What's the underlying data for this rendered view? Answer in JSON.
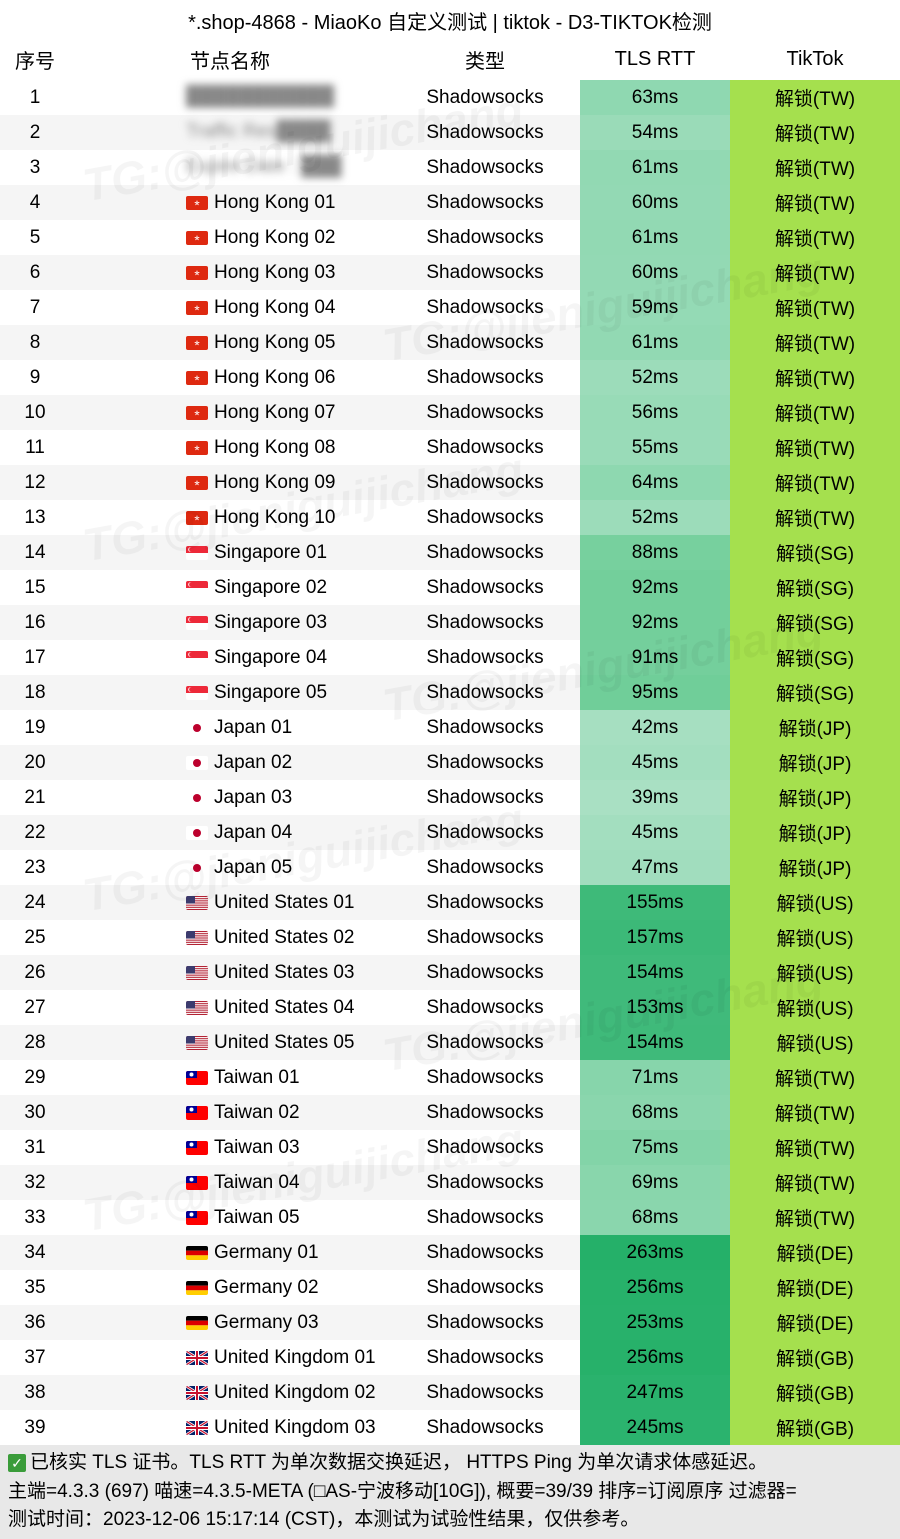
{
  "title": "*.shop-4868 - MiaoKo 自定义测试 | tiktok - D3-TIKTOK检测",
  "columns": {
    "idx": "序号",
    "name": "节点名称",
    "type": "类型",
    "rtt": "TLS RTT",
    "tiktok": "TikTok"
  },
  "watermark": "TG:@jieniguijichang",
  "nodes": [
    {
      "idx": 1,
      "flag": "",
      "name": "███████████",
      "type": "Shadowsocks",
      "rtt": "63ms",
      "rtt_bg": "#8fd8b1",
      "tt": "解锁(TW)",
      "tt_bg": "#a5e04e",
      "blur": true
    },
    {
      "idx": 2,
      "flag": "",
      "name": "Traffic Res████",
      "type": "Shadowsocks",
      "rtt": "54ms",
      "rtt_bg": "#9adbb8",
      "tt": "解锁(TW)",
      "tt_bg": "#a5e04e",
      "blur": true
    },
    {
      "idx": 3,
      "flag": "",
      "name": "Expire Date : ███",
      "type": "Shadowsocks",
      "rtt": "61ms",
      "rtt_bg": "#92d9b3",
      "tt": "解锁(TW)",
      "tt_bg": "#a5e04e",
      "blur": true
    },
    {
      "idx": 4,
      "flag": "hk",
      "name": "Hong Kong 01",
      "type": "Shadowsocks",
      "rtt": "60ms",
      "rtt_bg": "#93d9b4",
      "tt": "解锁(TW)",
      "tt_bg": "#a5e04e"
    },
    {
      "idx": 5,
      "flag": "hk",
      "name": "Hong Kong 02",
      "type": "Shadowsocks",
      "rtt": "61ms",
      "rtt_bg": "#92d9b3",
      "tt": "解锁(TW)",
      "tt_bg": "#a5e04e"
    },
    {
      "idx": 6,
      "flag": "hk",
      "name": "Hong Kong 03",
      "type": "Shadowsocks",
      "rtt": "60ms",
      "rtt_bg": "#93d9b4",
      "tt": "解锁(TW)",
      "tt_bg": "#a5e04e"
    },
    {
      "idx": 7,
      "flag": "hk",
      "name": "Hong Kong 04",
      "type": "Shadowsocks",
      "rtt": "59ms",
      "rtt_bg": "#94dab5",
      "tt": "解锁(TW)",
      "tt_bg": "#a5e04e"
    },
    {
      "idx": 8,
      "flag": "hk",
      "name": "Hong Kong 05",
      "type": "Shadowsocks",
      "rtt": "61ms",
      "rtt_bg": "#92d9b3",
      "tt": "解锁(TW)",
      "tt_bg": "#a5e04e"
    },
    {
      "idx": 9,
      "flag": "hk",
      "name": "Hong Kong 06",
      "type": "Shadowsocks",
      "rtt": "52ms",
      "rtt_bg": "#9cdcba",
      "tt": "解锁(TW)",
      "tt_bg": "#a5e04e"
    },
    {
      "idx": 10,
      "flag": "hk",
      "name": "Hong Kong 07",
      "type": "Shadowsocks",
      "rtt": "56ms",
      "rtt_bg": "#98dbb7",
      "tt": "解锁(TW)",
      "tt_bg": "#a5e04e"
    },
    {
      "idx": 11,
      "flag": "hk",
      "name": "Hong Kong 08",
      "type": "Shadowsocks",
      "rtt": "55ms",
      "rtt_bg": "#99dbb8",
      "tt": "解锁(TW)",
      "tt_bg": "#a5e04e"
    },
    {
      "idx": 12,
      "flag": "hk",
      "name": "Hong Kong 09",
      "type": "Shadowsocks",
      "rtt": "64ms",
      "rtt_bg": "#8ed8b0",
      "tt": "解锁(TW)",
      "tt_bg": "#a5e04e"
    },
    {
      "idx": 13,
      "flag": "hk",
      "name": "Hong Kong 10",
      "type": "Shadowsocks",
      "rtt": "52ms",
      "rtt_bg": "#9cdcba",
      "tt": "解锁(TW)",
      "tt_bg": "#a5e04e"
    },
    {
      "idx": 14,
      "flag": "sg",
      "name": "Singapore 01",
      "type": "Shadowsocks",
      "rtt": "88ms",
      "rtt_bg": "#77d09e",
      "tt": "解锁(SG)",
      "tt_bg": "#a5e04e"
    },
    {
      "idx": 15,
      "flag": "sg",
      "name": "Singapore 02",
      "type": "Shadowsocks",
      "rtt": "92ms",
      "rtt_bg": "#73cf9b",
      "tt": "解锁(SG)",
      "tt_bg": "#a5e04e"
    },
    {
      "idx": 16,
      "flag": "sg",
      "name": "Singapore 03",
      "type": "Shadowsocks",
      "rtt": "92ms",
      "rtt_bg": "#73cf9b",
      "tt": "解锁(SG)",
      "tt_bg": "#a5e04e"
    },
    {
      "idx": 17,
      "flag": "sg",
      "name": "Singapore 04",
      "type": "Shadowsocks",
      "rtt": "91ms",
      "rtt_bg": "#74cf9c",
      "tt": "解锁(SG)",
      "tt_bg": "#a5e04e"
    },
    {
      "idx": 18,
      "flag": "sg",
      "name": "Singapore 05",
      "type": "Shadowsocks",
      "rtt": "95ms",
      "rtt_bg": "#70ce99",
      "tt": "解锁(SG)",
      "tt_bg": "#a5e04e"
    },
    {
      "idx": 19,
      "flag": "jp",
      "name": "Japan 01",
      "type": "Shadowsocks",
      "rtt": "42ms",
      "rtt_bg": "#a6dfc1",
      "tt": "解锁(JP)",
      "tt_bg": "#a5e04e"
    },
    {
      "idx": 20,
      "flag": "jp",
      "name": "Japan 02",
      "type": "Shadowsocks",
      "rtt": "45ms",
      "rtt_bg": "#a3debf",
      "tt": "解锁(JP)",
      "tt_bg": "#a5e04e"
    },
    {
      "idx": 21,
      "flag": "jp",
      "name": "Japan 03",
      "type": "Shadowsocks",
      "rtt": "39ms",
      "rtt_bg": "#a9e0c3",
      "tt": "解锁(JP)",
      "tt_bg": "#a5e04e"
    },
    {
      "idx": 22,
      "flag": "jp",
      "name": "Japan 04",
      "type": "Shadowsocks",
      "rtt": "45ms",
      "rtt_bg": "#a3debf",
      "tt": "解锁(JP)",
      "tt_bg": "#a5e04e"
    },
    {
      "idx": 23,
      "flag": "jp",
      "name": "Japan 05",
      "type": "Shadowsocks",
      "rtt": "47ms",
      "rtt_bg": "#a1ddbe",
      "tt": "解锁(JP)",
      "tt_bg": "#a5e04e"
    },
    {
      "idx": 24,
      "flag": "us",
      "name": "United States 01",
      "type": "Shadowsocks",
      "rtt": "155ms",
      "rtt_bg": "#3eba79",
      "tt": "解锁(US)",
      "tt_bg": "#a5e04e"
    },
    {
      "idx": 25,
      "flag": "us",
      "name": "United States 02",
      "type": "Shadowsocks",
      "rtt": "157ms",
      "rtt_bg": "#3cb978",
      "tt": "解锁(US)",
      "tt_bg": "#a5e04e"
    },
    {
      "idx": 26,
      "flag": "us",
      "name": "United States 03",
      "type": "Shadowsocks",
      "rtt": "154ms",
      "rtt_bg": "#3fba7a",
      "tt": "解锁(US)",
      "tt_bg": "#a5e04e"
    },
    {
      "idx": 27,
      "flag": "us",
      "name": "United States 04",
      "type": "Shadowsocks",
      "rtt": "153ms",
      "rtt_bg": "#40ba7b",
      "tt": "解锁(US)",
      "tt_bg": "#a5e04e"
    },
    {
      "idx": 28,
      "flag": "us",
      "name": "United States 05",
      "type": "Shadowsocks",
      "rtt": "154ms",
      "rtt_bg": "#3fba7a",
      "tt": "解锁(US)",
      "tt_bg": "#a5e04e"
    },
    {
      "idx": 29,
      "flag": "tw",
      "name": "Taiwan 01",
      "type": "Shadowsocks",
      "rtt": "71ms",
      "rtt_bg": "#87d5ab",
      "tt": "解锁(TW)",
      "tt_bg": "#a5e04e"
    },
    {
      "idx": 30,
      "flag": "tw",
      "name": "Taiwan 02",
      "type": "Shadowsocks",
      "rtt": "68ms",
      "rtt_bg": "#8ad6ad",
      "tt": "解锁(TW)",
      "tt_bg": "#a5e04e"
    },
    {
      "idx": 31,
      "flag": "tw",
      "name": "Taiwan 03",
      "type": "Shadowsocks",
      "rtt": "75ms",
      "rtt_bg": "#83d4a8",
      "tt": "解锁(TW)",
      "tt_bg": "#a5e04e"
    },
    {
      "idx": 32,
      "flag": "tw",
      "name": "Taiwan 04",
      "type": "Shadowsocks",
      "rtt": "69ms",
      "rtt_bg": "#89d6ac",
      "tt": "解锁(TW)",
      "tt_bg": "#a5e04e"
    },
    {
      "idx": 33,
      "flag": "tw",
      "name": "Taiwan 05",
      "type": "Shadowsocks",
      "rtt": "68ms",
      "rtt_bg": "#8ad6ad",
      "tt": "解锁(TW)",
      "tt_bg": "#a5e04e"
    },
    {
      "idx": 34,
      "flag": "de",
      "name": "Germany 01",
      "type": "Shadowsocks",
      "rtt": "263ms",
      "rtt_bg": "#25b069",
      "tt": "解锁(DE)",
      "tt_bg": "#a5e04e"
    },
    {
      "idx": 35,
      "flag": "de",
      "name": "Germany 02",
      "type": "Shadowsocks",
      "rtt": "256ms",
      "rtt_bg": "#27b16a",
      "tt": "解锁(DE)",
      "tt_bg": "#a5e04e"
    },
    {
      "idx": 36,
      "flag": "de",
      "name": "Germany 03",
      "type": "Shadowsocks",
      "rtt": "253ms",
      "rtt_bg": "#28b16b",
      "tt": "解锁(DE)",
      "tt_bg": "#a5e04e"
    },
    {
      "idx": 37,
      "flag": "gb",
      "name": "United Kingdom 01",
      "type": "Shadowsocks",
      "rtt": "256ms",
      "rtt_bg": "#27b16a",
      "tt": "解锁(GB)",
      "tt_bg": "#a5e04e"
    },
    {
      "idx": 38,
      "flag": "gb",
      "name": "United Kingdom 02",
      "type": "Shadowsocks",
      "rtt": "247ms",
      "rtt_bg": "#2ab26d",
      "tt": "解锁(GB)",
      "tt_bg": "#a5e04e"
    },
    {
      "idx": 39,
      "flag": "gb",
      "name": "United Kingdom 03",
      "type": "Shadowsocks",
      "rtt": "245ms",
      "rtt_bg": "#2bb36e",
      "tt": "解锁(GB)",
      "tt_bg": "#a5e04e"
    }
  ],
  "footer": {
    "line1": "已核实 TLS 证书。TLS RTT 为单次数据交换延迟， HTTPS Ping 为单次请求体感延迟。",
    "line2": "主端=4.3.3 (697) 喵速=4.3.5-META (□AS-宁波移动[10G]), 概要=39/39 排序=订阅原序 过滤器=",
    "line3": "测试时间：2023-12-06 15:17:14 (CST)，本测试为试验性结果，仅供参考。"
  }
}
